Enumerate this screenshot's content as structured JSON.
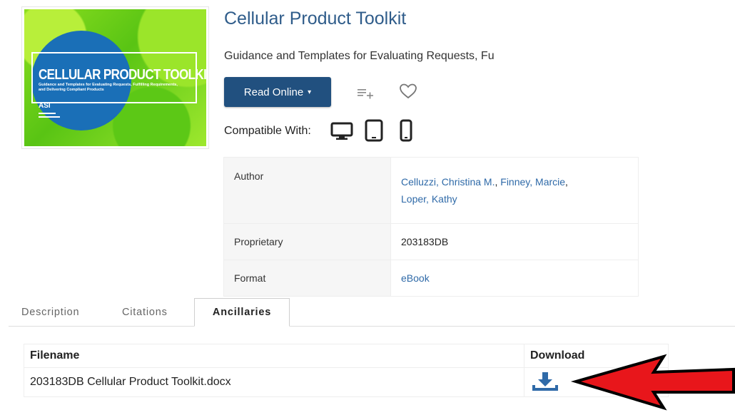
{
  "cover": {
    "title": "CELLULAR PRODUCT TOOLKIT",
    "subtitle": "Guidance and Templates for Evaluating Requests, Fulfilling Requirements, and Delivering Compliant Products",
    "logo": "ASI"
  },
  "book": {
    "title": "Cellular Product Toolkit",
    "subtitle": "Guidance and Templates for Evaluating Requests, Fu"
  },
  "actions": {
    "read_label": "Read Online",
    "read_caret": "▾",
    "playlist_icon": "add-to-list-icon",
    "favorite_icon": "heart-icon"
  },
  "compatibility": {
    "label": "Compatible With:",
    "devices": [
      "desktop-icon",
      "tablet-icon",
      "phone-icon"
    ]
  },
  "details": {
    "author_key": "Author",
    "authors": [
      "Celluzzi, Christina M.",
      "Finney, Marcie",
      "Loper, Kathy"
    ],
    "author_sep1": ", ",
    "author_sep2": ",",
    "proprietary_key": "Proprietary",
    "proprietary_value": "203183DB",
    "format_key": "Format",
    "format_value": "eBook"
  },
  "tabs": {
    "description": "Description",
    "citations": "Citations",
    "ancillaries": "Ancillaries",
    "active": "Ancillaries"
  },
  "files": {
    "headers": {
      "filename": "Filename",
      "download": "Download"
    },
    "rows": [
      {
        "filename": "203183DB Cellular Product Toolkit.docx",
        "download_icon": "download-icon"
      }
    ]
  },
  "colors": {
    "primary_button": "#21507f",
    "link": "#2f6aa8",
    "title": "#2f5c8a",
    "annotation_arrow": "#e8161b"
  }
}
